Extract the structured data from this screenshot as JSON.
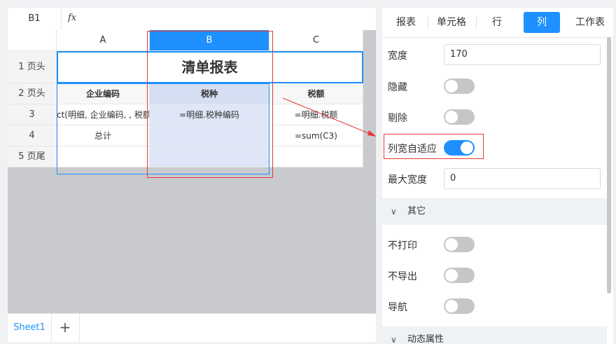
{
  "formula_bar": {
    "cell_ref": "B1",
    "fx_label": "fx"
  },
  "columns": [
    "A",
    "B",
    "C"
  ],
  "rows": [
    {
      "header": "1 页头",
      "cells": [
        "",
        "清单报表",
        ""
      ]
    },
    {
      "header": "2 页头",
      "cells": [
        "企业编码",
        "税种",
        "税额"
      ]
    },
    {
      "header": "3",
      "cells": [
        "ct(明细, 企业编码, , 税额",
        "=明细.税种编码",
        "=明细.税额"
      ]
    },
    {
      "header": "4",
      "cells": [
        "总计",
        "",
        "=sum(C3)"
      ]
    },
    {
      "header": "5 页尾",
      "cells": [
        "",
        "",
        ""
      ]
    }
  ],
  "sheet_tabs": {
    "active": "Sheet1",
    "add_label": "+"
  },
  "panel": {
    "tabs": [
      "报表",
      "单元格",
      "行",
      "列",
      "工作表"
    ],
    "active_tab": "列",
    "width_label": "宽度",
    "width_value": "170",
    "hidden_label": "隐藏",
    "hidden_on": false,
    "remove_label": "剔除",
    "remove_on": false,
    "autofit_label": "列宽自适应",
    "autofit_on": true,
    "max_width_label": "最大宽度",
    "max_width_value": "0",
    "section_other": "其它",
    "no_print_label": "不打印",
    "no_print_on": false,
    "no_export_label": "不导出",
    "no_export_on": false,
    "nav_label": "导航",
    "nav_on": false,
    "section_dynamic": "动态属性"
  },
  "colors": {
    "accent": "#1e90ff",
    "annotation": "#e53935",
    "grid_bg": "#c9cacd"
  }
}
